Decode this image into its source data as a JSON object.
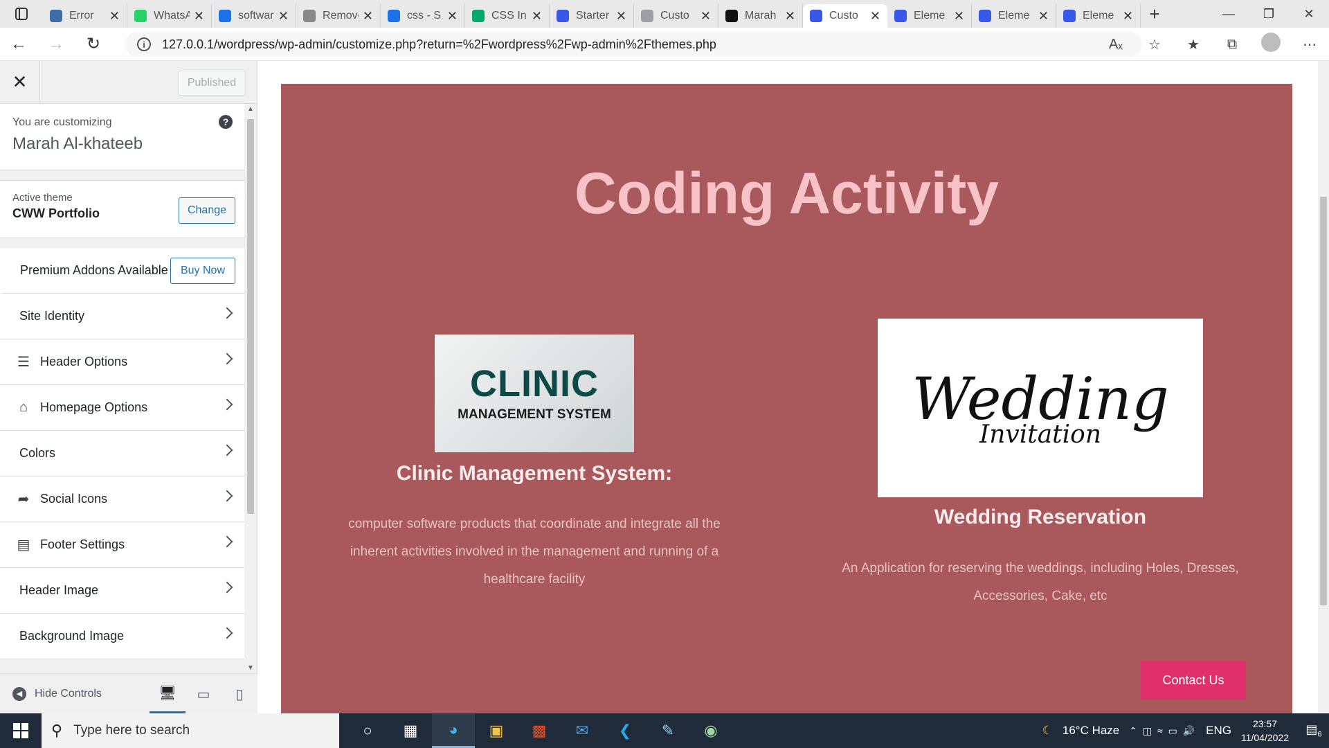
{
  "browser": {
    "tabs": [
      {
        "title": "Error",
        "icon": "page-icon",
        "color": "#3d6ea8"
      },
      {
        "title": "WhatsApp",
        "icon": "whatsapp-icon",
        "color": "#25d366"
      },
      {
        "title": "software",
        "icon": "bing-icon",
        "color": "#1a73e8"
      },
      {
        "title": "Remove",
        "icon": "page-icon",
        "color": "#888888"
      },
      {
        "title": "css - S",
        "icon": "search-icon",
        "color": "#1a73e8"
      },
      {
        "title": "CSS In",
        "icon": "w3-icon",
        "color": "#04aa6d"
      },
      {
        "title": "Starter",
        "icon": "wordpress-icon",
        "color": "#3858e9"
      },
      {
        "title": "Custo",
        "icon": "wordpress-icon",
        "color": "#9aa0a6"
      },
      {
        "title": "Marah",
        "icon": "github-icon",
        "color": "#111111"
      },
      {
        "title": "Custo",
        "icon": "wordpress-icon",
        "color": "#3858e9",
        "active": true
      },
      {
        "title": "Eleme",
        "icon": "wordpress-icon",
        "color": "#3858e9"
      },
      {
        "title": "Eleme",
        "icon": "wordpress-icon",
        "color": "#3858e9"
      },
      {
        "title": "Eleme",
        "icon": "wordpress-icon",
        "color": "#3858e9"
      }
    ],
    "url": "127.0.0.1/wordpress/wp-admin/customize.php?return=%2Fwordpress%2Fwp-admin%2Fthemes.php"
  },
  "sidebar": {
    "published_label": "Published",
    "customizing_label": "You are customizing",
    "site_name": "Marah Al-khateeb",
    "active_theme_label": "Active theme",
    "theme_name": "CWW Portfolio",
    "change_label": "Change",
    "premium_label": "Premium Addons Available",
    "buy_now_label": "Buy Now",
    "menu": [
      {
        "label": "Site Identity",
        "icon": ""
      },
      {
        "label": "Header Options",
        "icon": "menu-lines-icon"
      },
      {
        "label": "Homepage Options",
        "icon": "home-icon"
      },
      {
        "label": "Colors",
        "icon": ""
      },
      {
        "label": "Social Icons",
        "icon": "share-icon"
      },
      {
        "label": "Footer Settings",
        "icon": "footer-icon"
      },
      {
        "label": "Header Image",
        "icon": ""
      },
      {
        "label": "Background Image",
        "icon": ""
      }
    ],
    "hide_controls_label": "Hide Controls"
  },
  "preview": {
    "section_title": "Coding Activity",
    "projects": [
      {
        "image_big": "CLINIC",
        "image_small": "MANAGEMENT SYSTEM",
        "title": "Clinic Management System:",
        "description": "computer software products that coordinate and integrate all the inherent activities involved in the management and running of a healthcare facility"
      },
      {
        "image_big": "Wedding",
        "image_small": "Invitation",
        "title": "Wedding Reservation",
        "description": "An Application for reserving the weddings, including Holes, Dresses, Accessories, Cake, etc"
      }
    ],
    "contact_label": "Contact Us",
    "colors": {
      "section_bg": "#a9585b",
      "title": "#f7c3c6",
      "button": "#e0306b"
    }
  },
  "taskbar": {
    "search_placeholder": "Type here to search",
    "weather": "16°C  Haze",
    "lang": "ENG",
    "time": "23:57",
    "date": "11/04/2022",
    "notifications": "6"
  }
}
